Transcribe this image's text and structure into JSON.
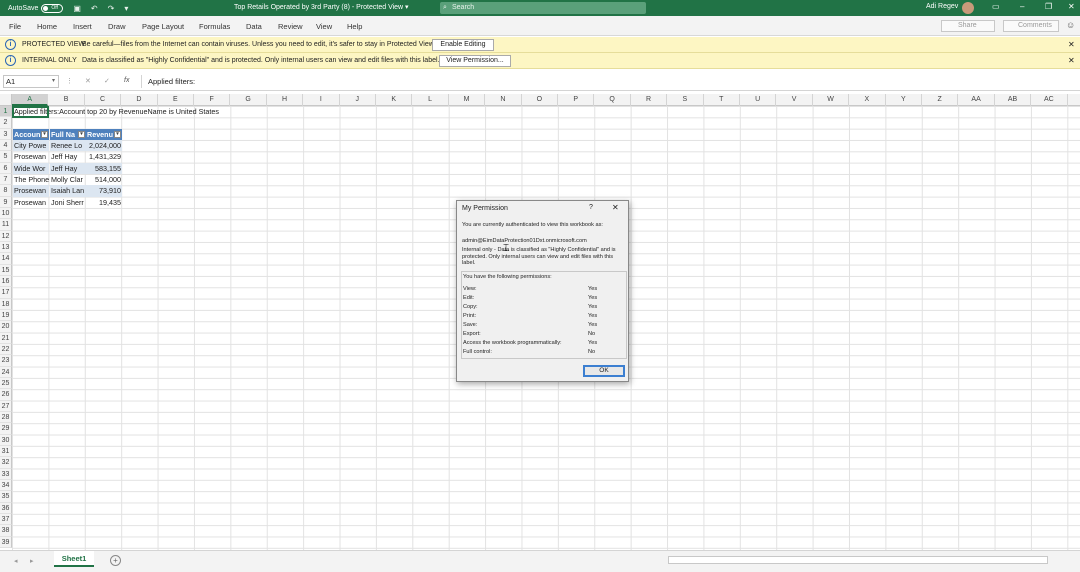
{
  "titlebar": {
    "autosave_label": "AutoSave",
    "autosave_state": "Off",
    "doc_title": "Top Retails Operated by 3rd Party (8)  -  Protected View  ▾",
    "search_placeholder": "Search",
    "user_name": "Adi Regev",
    "accent_color": "#217346"
  },
  "ribbon": {
    "tabs": [
      "File",
      "Home",
      "Insert",
      "Draw",
      "Page Layout",
      "Formulas",
      "Data",
      "Review",
      "View",
      "Help"
    ],
    "share_label": "Share",
    "comments_label": "Comments"
  },
  "infobars": [
    {
      "label": "PROTECTED VIEW",
      "message": "Be careful—files from the Internet can contain viruses. Unless you need to edit, it's safer to stay in Protected View.",
      "button": "Enable Editing"
    },
    {
      "label": "INTERNAL ONLY",
      "message": "Data is classified as \"Highly Confidential\" and is protected. Only internal users can view and edit files with this label.",
      "button": "View Permission..."
    }
  ],
  "formulabar": {
    "name_box": "A1",
    "formula": "Applied filters:"
  },
  "grid": {
    "columns": [
      "A",
      "B",
      "C",
      "D",
      "E",
      "F",
      "G",
      "H",
      "I",
      "J",
      "K",
      "L",
      "M",
      "N",
      "O",
      "P",
      "Q",
      "R",
      "S",
      "T",
      "U",
      "V",
      "W",
      "X",
      "Y",
      "Z",
      "AA",
      "AB",
      "AC"
    ],
    "rows": [
      "1",
      "2",
      "3",
      "4",
      "5",
      "6",
      "7",
      "8",
      "9",
      "10",
      "11",
      "12",
      "13",
      "14",
      "15",
      "16",
      "17",
      "18",
      "19",
      "20",
      "21",
      "22",
      "23",
      "24",
      "25",
      "26",
      "27",
      "28",
      "29",
      "30",
      "31",
      "32",
      "33",
      "34",
      "35",
      "36",
      "37",
      "38",
      "39"
    ],
    "a1_text": "Applied filters:Account top 20 by RevenueName is United States",
    "table_headers": [
      "Accoun",
      "Full Na",
      "Revenu"
    ],
    "table_rows": [
      [
        "City Powe",
        "Renee Lo",
        "2,024,000"
      ],
      [
        "Prosewan",
        "Jeff Hay",
        "1,431,329"
      ],
      [
        "Wide Wor",
        "Jeff Hay",
        "583,155"
      ],
      [
        "The Phone",
        "Molly Clar",
        "514,000"
      ],
      [
        "Prosewan",
        "Isaiah Lan",
        "73,910"
      ],
      [
        "Prosewan",
        "Joni Sherr",
        "19,435"
      ]
    ],
    "header_color": "#4f81bd",
    "band_color": "#dce6f1"
  },
  "sheetbar": {
    "sheet_name": "Sheet1"
  },
  "dialog": {
    "title": "My Permission",
    "help": "?",
    "intro": "You are currently authenticated to view this workbook as:",
    "account": "admin@EimDataProtection01Dxt.onmicrosoft.com",
    "classification": "Internal only - Data is classified as \"Highly Confidential\" and is protected. Only internal users can view and edit files with this label.",
    "perm_heading": "You have the following permissions:",
    "permissions": [
      {
        "name": "View:",
        "value": "Yes"
      },
      {
        "name": "Edit:",
        "value": "Yes"
      },
      {
        "name": "Copy:",
        "value": "Yes"
      },
      {
        "name": "Print:",
        "value": "Yes"
      },
      {
        "name": "Save:",
        "value": "Yes"
      },
      {
        "name": "Export:",
        "value": "No"
      },
      {
        "name": "Access the workbook programmatically:",
        "value": "Yes"
      },
      {
        "name": "Full control:",
        "value": "No"
      }
    ],
    "ok_label": "OK"
  }
}
